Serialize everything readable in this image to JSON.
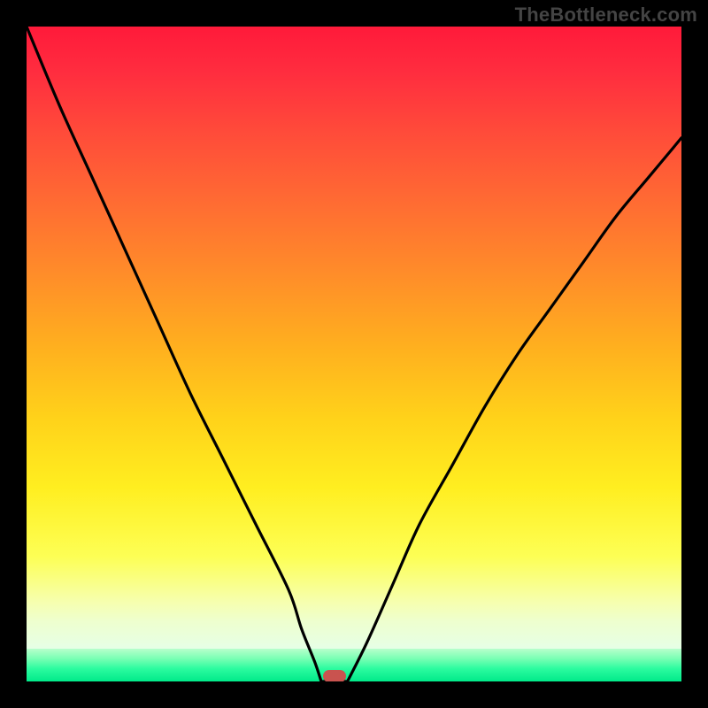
{
  "watermark": "TheBottleneck.com",
  "colors": {
    "frame_border": "#000000",
    "curve": "#000000",
    "marker": "#c9534f",
    "gradient_top": "#ff1a3a",
    "gradient_mid": "#ffd21a",
    "gradient_bottom": "#00ea8a"
  },
  "chart_data": {
    "type": "line",
    "title": "",
    "xlabel": "",
    "ylabel": "",
    "xlim": [
      0,
      100
    ],
    "ylim": [
      0,
      100
    ],
    "grid": false,
    "legend": false,
    "series": [
      {
        "name": "left-descent",
        "x": [
          0,
          5,
          10,
          15,
          20,
          25,
          30,
          35,
          40,
          42,
          44,
          45
        ],
        "y": [
          100,
          88,
          77,
          66,
          55,
          44,
          34,
          24,
          14,
          8,
          3,
          0
        ]
      },
      {
        "name": "right-ascent",
        "x": [
          49,
          52,
          56,
          60,
          65,
          70,
          75,
          80,
          85,
          90,
          95,
          100
        ],
        "y": [
          0,
          6,
          15,
          24,
          33,
          42,
          50,
          57,
          64,
          71,
          77,
          83
        ]
      },
      {
        "name": "valley-floor",
        "x": [
          45,
          46,
          47,
          48,
          49
        ],
        "y": [
          0,
          0,
          0,
          0,
          0
        ]
      }
    ],
    "marker": {
      "x": 47,
      "y": 0,
      "shape": "rounded-rect",
      "color": "#c9534f"
    },
    "annotations": []
  }
}
